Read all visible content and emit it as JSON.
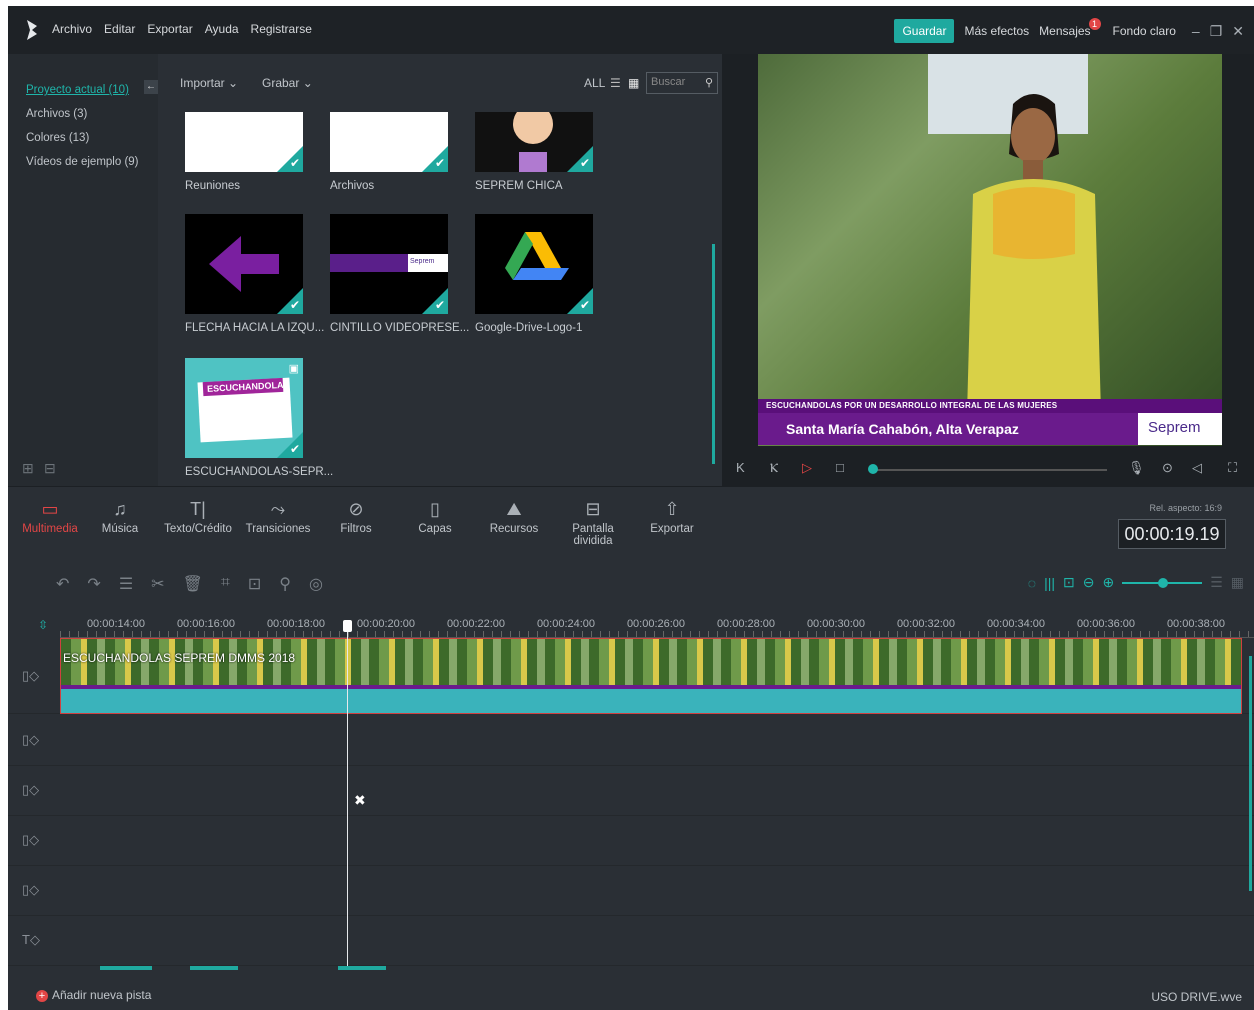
{
  "menu": [
    "Archivo",
    "Editar",
    "Exportar",
    "Ayuda",
    "Registrarse"
  ],
  "topright": {
    "save": "Guardar",
    "more_effects": "Más efectos",
    "messages": "Mensajes",
    "messages_badge": "1",
    "light_mode": "Fondo claro"
  },
  "library": {
    "items": [
      {
        "label": "Proyecto actual (10)"
      },
      {
        "label": "Archivos (3)"
      },
      {
        "label": "Colores (13)"
      },
      {
        "label": "Vídeos de ejemplo (9)"
      }
    ]
  },
  "media_toolbar": {
    "import": "Importar",
    "record": "Grabar",
    "all": "ALL",
    "search_placeholder": "Buscar"
  },
  "media_items": [
    {
      "label": "Reuniones"
    },
    {
      "label": "Archivos"
    },
    {
      "label": "SEPREM CHICA"
    },
    {
      "label": "FLECHA HACIA LA IZQU..."
    },
    {
      "label": "CINTILLO VIDEOPRESE..."
    },
    {
      "label": "Google-Drive-Logo-1"
    },
    {
      "label": "ESCUCHANDOLAS-SEPR..."
    }
  ],
  "thumb_text": {
    "escuchandolas": "ESCUCHANDOLAS",
    "seprem": "Seprem"
  },
  "preview": {
    "lower_third_top": "ESCUCHANDOLAS POR UN DESARROLLO INTEGRAL DE LAS MUJERES",
    "lower_third_main": "Santa María Cahabón, Alta Verapaz",
    "logo": "Seprem",
    "progress": 0.02
  },
  "tools": [
    {
      "label": "Multimedia",
      "icon": "folder-icon"
    },
    {
      "label": "Música",
      "icon": "music-icon"
    },
    {
      "label": "Texto/Crédito",
      "icon": "text-icon"
    },
    {
      "label": "Transiciones",
      "icon": "transition-icon"
    },
    {
      "label": "Filtros",
      "icon": "filter-icon"
    },
    {
      "label": "Capas",
      "icon": "overlay-icon"
    },
    {
      "label": "Recursos",
      "icon": "elements-icon"
    },
    {
      "label": "Pantalla dividida",
      "icon": "split-screen-icon"
    },
    {
      "label": "Exportar",
      "icon": "export-icon"
    }
  ],
  "aspect_label": "Rel. aspecto: 16:9",
  "timecode": "00:00:19.19",
  "ruler": [
    "00:00:14:00",
    "00:00:16:00",
    "00:00:18:00",
    "00:00:20:00",
    "00:00:22:00",
    "00:00:24:00",
    "00:00:26:00",
    "00:00:28:00",
    "00:00:30:00",
    "00:00:32:00",
    "00:00:34:00",
    "00:00:36:00",
    "00:00:38:00"
  ],
  "clip_label": "ESCUCHANDOLAS SEPREM DMMS 2018",
  "add_track": "Añadir nueva pista",
  "project_file": "USO DRIVE.wve",
  "colors": {
    "accent": "#1fa99f",
    "record": "#e24646",
    "purple": "#6a1b8c"
  }
}
